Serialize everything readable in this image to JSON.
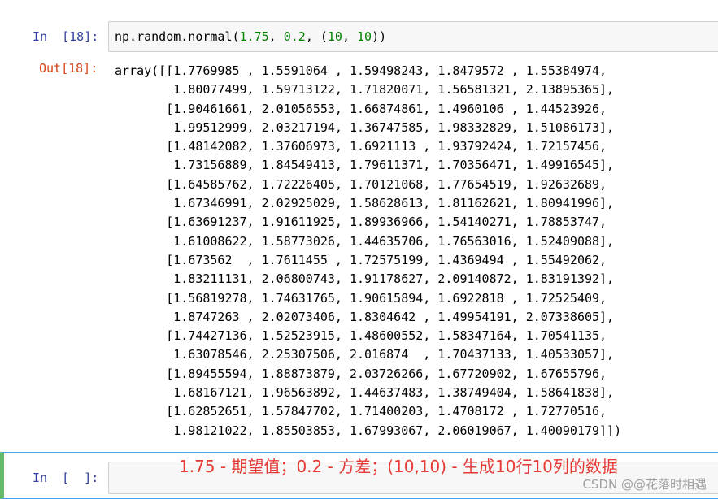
{
  "cell1": {
    "in_prompt": "In  [18]:",
    "code": {
      "fn": "np.random.normal(",
      "a": "1.75",
      "sep1": ", ",
      "b": "0.2",
      "sep2": ", (",
      "c": "10",
      "sep3": ", ",
      "d": "10",
      "close": "))"
    },
    "out_prompt": "Out[18]:",
    "output_lines": [
      "array([[1.7769985 , 1.5591064 , 1.59498243, 1.8479572 , 1.55384974,",
      "        1.80077499, 1.59713122, 1.71820071, 1.56581321, 2.13895365],",
      "       [1.90461661, 2.01056553, 1.66874861, 1.4960106 , 1.44523926,",
      "        1.99512999, 2.03217194, 1.36747585, 1.98332829, 1.51086173],",
      "       [1.48142082, 1.37606973, 1.6921113 , 1.93792424, 1.72157456,",
      "        1.73156889, 1.84549413, 1.79611371, 1.70356471, 1.49916545],",
      "       [1.64585762, 1.72226405, 1.70121068, 1.77654519, 1.92632689,",
      "        1.67346991, 2.02925029, 1.58628613, 1.81162621, 1.80941996],",
      "       [1.63691237, 1.91611925, 1.89936966, 1.54140271, 1.78853747,",
      "        1.61008622, 1.58773026, 1.44635706, 1.76563016, 1.52409088],",
      "       [1.673562  , 1.7611455 , 1.72575199, 1.4369494 , 1.55492062,",
      "        1.83211131, 2.06800743, 1.91178627, 2.09140872, 1.83191392],",
      "       [1.56819278, 1.74631765, 1.90615894, 1.6922818 , 1.72525409,",
      "        1.8747263 , 2.02073406, 1.8304642 , 1.49954191, 2.07338605],",
      "       [1.74427136, 1.52523915, 1.48600552, 1.58347164, 1.70541135,",
      "        1.63078546, 2.25307506, 2.016874  , 1.70437133, 1.40533057],",
      "       [1.89455594, 1.88873879, 2.03726266, 1.67720902, 1.67655796,",
      "        1.68167121, 1.96563892, 1.44637483, 1.38749404, 1.58641838],",
      "       [1.62852651, 1.57847702, 1.71400203, 1.4708172 , 1.72770516,",
      "        1.98121022, 1.85503853, 1.67993067, 2.06019067, 1.40090179]])"
    ]
  },
  "cell2": {
    "in_prompt": "In  [  ]:"
  },
  "annotation": "1.75 - 期望值；0.2 - 方差；(10,10) - 生成10行10列的数据",
  "watermark": "CSDN @@花落时相遇",
  "colors": {
    "in_prompt": "#303f9f",
    "out_prompt": "#d84315",
    "number": "#008000",
    "annotation": "#e53935",
    "active_cell_border": "#42a5f5",
    "active_cell_left": "#66bb6a"
  }
}
